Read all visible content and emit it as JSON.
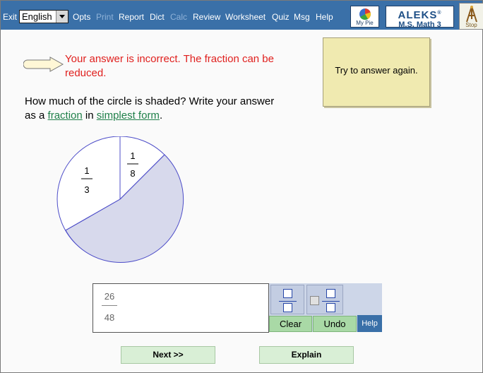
{
  "menu": {
    "exit": "Exit",
    "language": "English",
    "opts": "Opts",
    "print": "Print",
    "report": "Report",
    "dict": "Dict",
    "calc": "Calc",
    "review": "Review",
    "worksheet": "Worksheet",
    "quiz": "Quiz",
    "msg": "Msg",
    "help": "Help"
  },
  "logo": {
    "mypie_label": "My Pie",
    "aleks_title": "ALEKS",
    "aleks_registered": "®",
    "aleks_course": "M.S. Math 3",
    "stop_label": "Stop"
  },
  "feedback": {
    "message": "Your answer is incorrect. The fraction can be reduced.",
    "retry_text": "Try to answer again."
  },
  "question": {
    "text_before": "How much of the circle is shaded? Write your answer as a ",
    "link1": "fraction",
    "text_middle": " in ",
    "link2": "simplest form",
    "text_after": "."
  },
  "pie": {
    "label_1_num": "1",
    "label_1_den": "8",
    "label_2_num": "1",
    "label_2_den": "3",
    "shaded_color": "#d7d9ec",
    "outline_color": "#4c4cc8"
  },
  "answer": {
    "numerator": "26",
    "denominator": "48"
  },
  "tools": {
    "fraction_icon": "fraction-icon",
    "mixed_number_icon": "mixed-number-icon",
    "clear": "Clear",
    "undo": "Undo",
    "help": "Help"
  },
  "nav": {
    "next": "Next >>",
    "explain": "Explain"
  }
}
